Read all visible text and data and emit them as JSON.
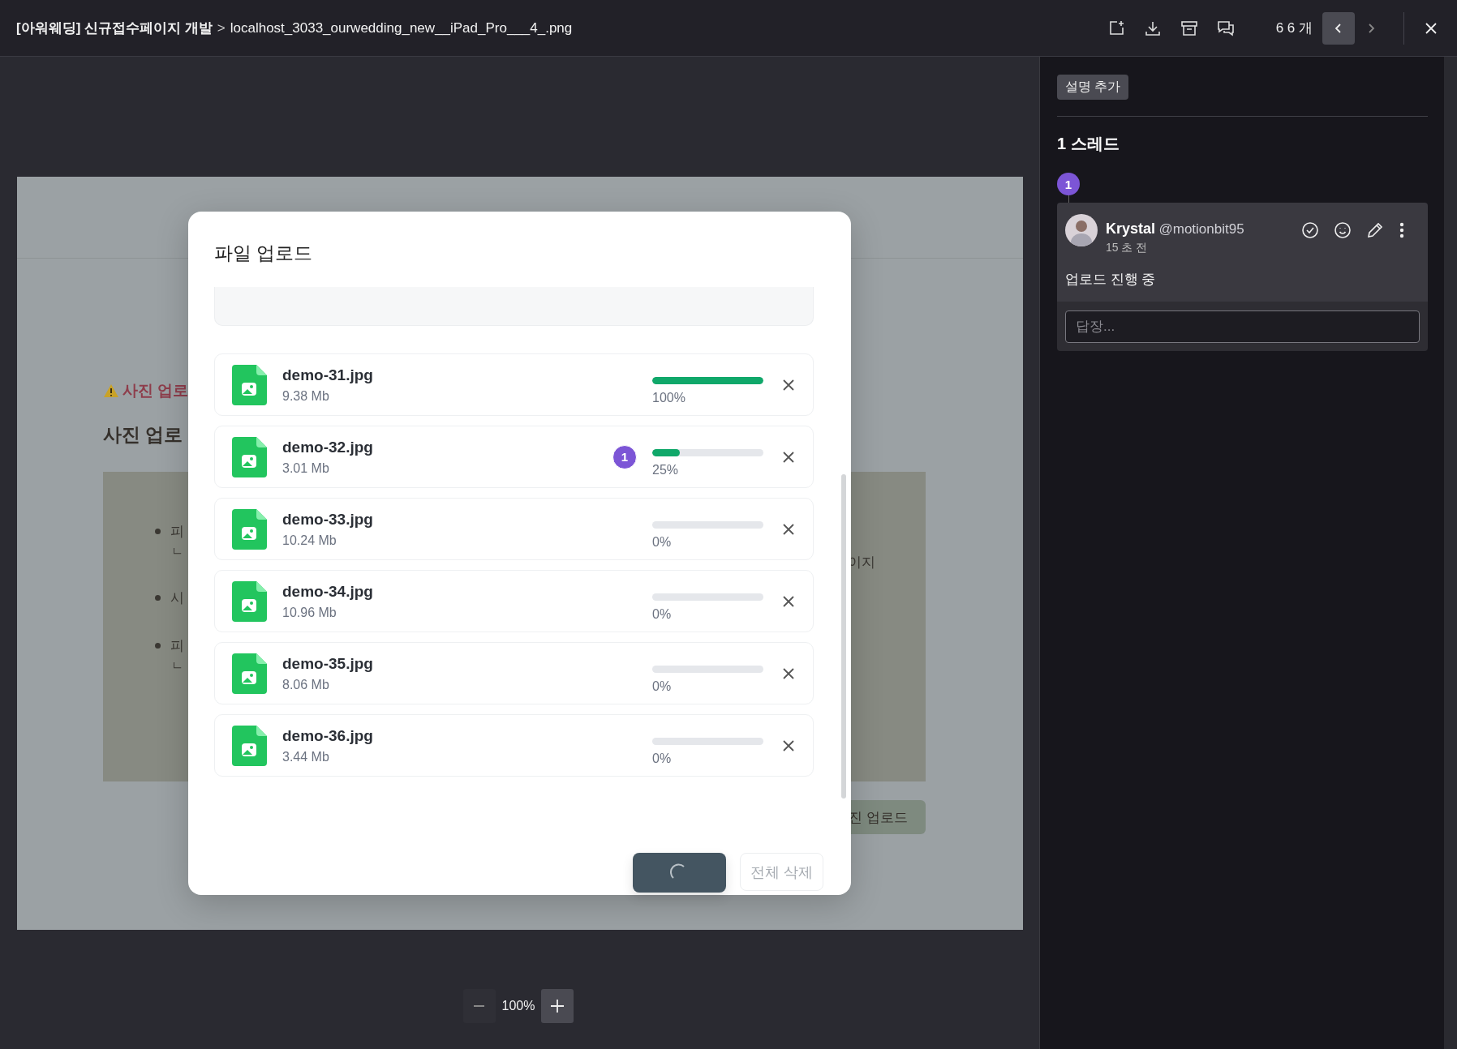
{
  "header": {
    "project": "[아워웨딩] 신규접수페이지 개발",
    "separator": ">",
    "file": "localhost_3033_ourwedding_new__iPad_Pro___4_.png",
    "counter": "6 6 개"
  },
  "page": {
    "warning": "사진 업로",
    "heading": "사진 업로",
    "bullets": [
      {
        "text": "피",
        "continuation": "ㄴ"
      },
      {
        "text": "시"
      },
      {
        "text": "피",
        "continuation": "ㄴ"
      }
    ],
    "right_fragment": "이지",
    "upload_button": "진 업로드"
  },
  "modal": {
    "title": "파일 업로드",
    "files": [
      {
        "name": "demo-31.jpg",
        "size": "9.38 Mb",
        "level": 1,
        "percent": "100%"
      },
      {
        "name": "demo-32.jpg",
        "size": "3.01 Mb",
        "level": 0.25,
        "percent": "25%",
        "pin": "1"
      },
      {
        "name": "demo-33.jpg",
        "size": "10.24 Mb",
        "level": 0,
        "percent": "0%"
      },
      {
        "name": "demo-34.jpg",
        "size": "10.96 Mb",
        "level": 0,
        "percent": "0%"
      },
      {
        "name": "demo-35.jpg",
        "size": "8.06 Mb",
        "level": 0,
        "percent": "0%"
      },
      {
        "name": "demo-36.jpg",
        "size": "3.44 Mb",
        "level": 0,
        "percent": "0%"
      }
    ],
    "upload_button": {
      "loading": true
    },
    "delete_button": "전체 삭제"
  },
  "sidebar": {
    "add_description": "설명 추가",
    "thread_count": "1 스레드",
    "pin": "1",
    "comment": {
      "author": "Krystal",
      "handle": "@motionbit95",
      "time": "15 초 전",
      "message": "업로드 진행 중"
    },
    "reply": {
      "placeholder": "답장..."
    }
  },
  "zoom": {
    "value": "100%"
  }
}
